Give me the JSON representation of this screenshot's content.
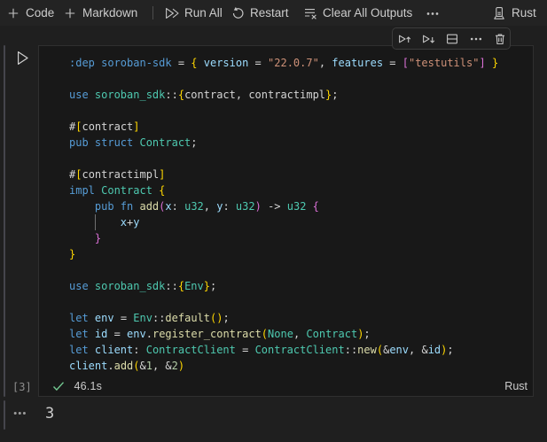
{
  "toolbar": {
    "add_code": "Code",
    "add_markdown": "Markdown",
    "run_all": "Run All",
    "restart": "Restart",
    "clear_all_outputs": "Clear All Outputs",
    "kernel": "Rust"
  },
  "cell_toolbar": {
    "icons": [
      "execute-above",
      "execute-cell-and-below",
      "split-cell",
      "more-actions",
      "delete-cell"
    ]
  },
  "cell": {
    "execution_label": "[3]",
    "status_duration": "46.1s",
    "language": "Rust",
    "code_lines": [
      [
        [
          "kw",
          ":dep soroban-sdk"
        ],
        [
          "fg",
          " = "
        ],
        [
          "b1",
          "{"
        ],
        [
          "fg",
          " "
        ],
        [
          "var",
          "version"
        ],
        [
          "fg",
          " = "
        ],
        [
          "str",
          "\"22.0.7\""
        ],
        [
          "fg",
          ", "
        ],
        [
          "var",
          "features"
        ],
        [
          "fg",
          " = "
        ],
        [
          "b2",
          "["
        ],
        [
          "str",
          "\"testutils\""
        ],
        [
          "b2",
          "]"
        ],
        [
          "fg",
          " "
        ],
        [
          "b1",
          "}"
        ]
      ],
      [],
      [
        [
          "kw",
          "use "
        ],
        [
          "type",
          "soroban_sdk"
        ],
        [
          "fg",
          "::"
        ],
        [
          "b1",
          "{"
        ],
        [
          "fg",
          "contract, contractimpl"
        ],
        [
          "b1",
          "}"
        ],
        [
          "fg",
          ";"
        ]
      ],
      [],
      [
        [
          "fg",
          "#"
        ],
        [
          "b1",
          "["
        ],
        [
          "fg",
          "contract"
        ],
        [
          "b1",
          "]"
        ]
      ],
      [
        [
          "kw",
          "pub struct "
        ],
        [
          "type",
          "Contract"
        ],
        [
          "fg",
          ";"
        ]
      ],
      [],
      [
        [
          "fg",
          "#"
        ],
        [
          "b1",
          "["
        ],
        [
          "fg",
          "contractimpl"
        ],
        [
          "b1",
          "]"
        ]
      ],
      [
        [
          "kw",
          "impl "
        ],
        [
          "type",
          "Contract"
        ],
        [
          "fg",
          " "
        ],
        [
          "b1",
          "{"
        ]
      ],
      [
        [
          "fg",
          "    "
        ],
        [
          "kw",
          "pub fn "
        ],
        [
          "fn",
          "add"
        ],
        [
          "b2",
          "("
        ],
        [
          "var",
          "x"
        ],
        [
          "fg",
          ": "
        ],
        [
          "type",
          "u32"
        ],
        [
          "fg",
          ", "
        ],
        [
          "var",
          "y"
        ],
        [
          "fg",
          ": "
        ],
        [
          "type",
          "u32"
        ],
        [
          "b2",
          ")"
        ],
        [
          "fg",
          " -> "
        ],
        [
          "type",
          "u32"
        ],
        [
          "fg",
          " "
        ],
        [
          "b2",
          "{"
        ]
      ],
      [
        [
          "fg",
          "        "
        ],
        [
          "var",
          "x"
        ],
        [
          "fg",
          "+"
        ],
        [
          "var",
          "y"
        ]
      ],
      [
        [
          "fg",
          "    "
        ],
        [
          "b2",
          "}"
        ]
      ],
      [
        [
          "b1",
          "}"
        ]
      ],
      [],
      [
        [
          "kw",
          "use "
        ],
        [
          "type",
          "soroban_sdk"
        ],
        [
          "fg",
          "::"
        ],
        [
          "b1",
          "{"
        ],
        [
          "type",
          "Env"
        ],
        [
          "b1",
          "}"
        ],
        [
          "fg",
          ";"
        ]
      ],
      [],
      [
        [
          "kw",
          "let "
        ],
        [
          "var",
          "env"
        ],
        [
          "fg",
          " = "
        ],
        [
          "type",
          "Env"
        ],
        [
          "fg",
          "::"
        ],
        [
          "fn",
          "default"
        ],
        [
          "b1",
          "()"
        ],
        [
          "fg",
          ";"
        ]
      ],
      [
        [
          "kw",
          "let "
        ],
        [
          "var",
          "id"
        ],
        [
          "fg",
          " = "
        ],
        [
          "var",
          "env"
        ],
        [
          "fg",
          "."
        ],
        [
          "fn",
          "register_contract"
        ],
        [
          "b1",
          "("
        ],
        [
          "type",
          "None"
        ],
        [
          "fg",
          ", "
        ],
        [
          "type",
          "Contract"
        ],
        [
          "b1",
          ")"
        ],
        [
          "fg",
          ";"
        ]
      ],
      [
        [
          "kw",
          "let "
        ],
        [
          "var",
          "client"
        ],
        [
          "fg",
          ": "
        ],
        [
          "type",
          "ContractClient"
        ],
        [
          "fg",
          " = "
        ],
        [
          "type",
          "ContractClient"
        ],
        [
          "fg",
          "::"
        ],
        [
          "fn",
          "new"
        ],
        [
          "b1",
          "("
        ],
        [
          "fg",
          "&"
        ],
        [
          "var",
          "env"
        ],
        [
          "fg",
          ", &"
        ],
        [
          "var",
          "id"
        ],
        [
          "b1",
          ")"
        ],
        [
          "fg",
          ";"
        ]
      ],
      [
        [
          "var",
          "client"
        ],
        [
          "fg",
          "."
        ],
        [
          "fn",
          "add"
        ],
        [
          "b1",
          "("
        ],
        [
          "fg",
          "&"
        ],
        [
          "num",
          "1"
        ],
        [
          "fg",
          ", &"
        ],
        [
          "num",
          "2"
        ],
        [
          "b1",
          ")"
        ]
      ]
    ]
  },
  "output": {
    "value": "3"
  },
  "colors": {
    "kw": "#569CD6",
    "type": "#4EC9B0",
    "var": "#9CDCFE",
    "fn": "#DCDCAA",
    "str": "#CE9178",
    "num": "#B5CEA8",
    "fg": "#D4D4D4",
    "b1": "#FFD700",
    "b2": "#DA70D6",
    "success": "#73C991",
    "accent_background": "#1F1F1F",
    "cell_background": "#181818"
  }
}
